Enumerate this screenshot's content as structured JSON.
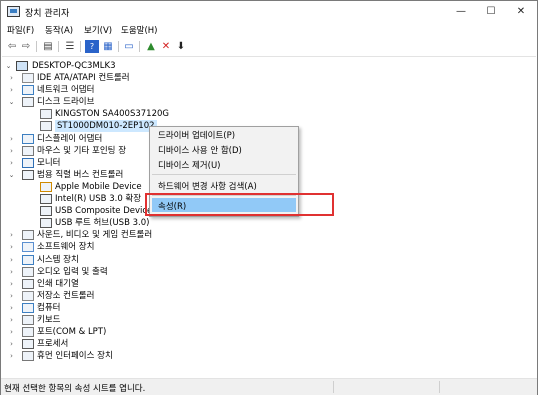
{
  "window": {
    "title": "장치 관리자",
    "buttons": {
      "minimize": "—",
      "maximize": "☐",
      "close": "✕"
    }
  },
  "menu": [
    "파일(F)",
    "동작(A)",
    "보기(V)",
    "도움말(H)"
  ],
  "toolbar_icons": [
    "back-arrow-icon",
    "forward-arrow-icon",
    "properties-icon",
    "list-icon",
    "help-icon",
    "device-view-icon",
    "monitor-icon",
    "add-driver-icon",
    "uninstall-icon",
    "disable-icon"
  ],
  "tree": {
    "root": "DESKTOP-QC3MLK3",
    "items": [
      {
        "label": "IDE ATA/ATAPI 컨트롤러",
        "expander": "›",
        "icon": "ide-controller-icon"
      },
      {
        "label": "네트워크 어댑터",
        "expander": "›",
        "icon": "network-adapter-icon"
      },
      {
        "label": "디스크 드라이브",
        "expander": "⌄",
        "icon": "disk-drive-icon"
      },
      {
        "label": "KINGSTON SA400S37120G",
        "expander": "",
        "icon": "disk-icon"
      },
      {
        "label": "ST1000DM010-2EP102",
        "expander": "",
        "icon": "disk-icon"
      },
      {
        "label": "디스플레이 어댑터",
        "expander": "›",
        "icon": "display-adapter-icon"
      },
      {
        "label": "마우스 및 기타 포인팅 장",
        "expander": "›",
        "icon": "mouse-icon"
      },
      {
        "label": "모니터",
        "expander": "›",
        "icon": "monitor-icon"
      },
      {
        "label": "범용 직렬 버스 컨트롤러",
        "expander": "⌄",
        "icon": "usb-controller-icon"
      },
      {
        "label": "Apple Mobile Device",
        "expander": "",
        "icon": "warning-device-icon"
      },
      {
        "label": "Intel(R) USB 3.0 확장",
        "expander": "",
        "icon": "usb-icon"
      },
      {
        "label": "USB Composite Device",
        "expander": "",
        "icon": "usb-icon"
      },
      {
        "label": "USB 루트 허브(USB 3.0)",
        "expander": "",
        "icon": "usb-icon"
      },
      {
        "label": "사운드, 비디오 및 게임 컨트롤러",
        "expander": "›",
        "icon": "sound-icon"
      },
      {
        "label": "소프트웨어 장치",
        "expander": "›",
        "icon": "software-device-icon"
      },
      {
        "label": "시스템 장치",
        "expander": "›",
        "icon": "system-device-icon"
      },
      {
        "label": "오디오 입력 및 출력",
        "expander": "›",
        "icon": "audio-icon"
      },
      {
        "label": "인쇄 대기열",
        "expander": "›",
        "icon": "printer-icon"
      },
      {
        "label": "저장소 컨트롤러",
        "expander": "›",
        "icon": "storage-controller-icon"
      },
      {
        "label": "컴퓨터",
        "expander": "›",
        "icon": "computer-icon"
      },
      {
        "label": "키보드",
        "expander": "›",
        "icon": "keyboard-icon"
      },
      {
        "label": "포트(COM & LPT)",
        "expander": "›",
        "icon": "port-icon"
      },
      {
        "label": "프로세서",
        "expander": "›",
        "icon": "processor-icon"
      },
      {
        "label": "휴먼 인터페이스 장치",
        "expander": "›",
        "icon": "hid-icon"
      }
    ]
  },
  "context_menu": {
    "items": [
      "드라이버 업데이트(P)",
      "디바이스 사용 안 함(D)",
      "디바이스 제거(U)",
      "하드웨어 변경 사항 검색(A)",
      "속성(R)"
    ],
    "highlighted": "속성(R)"
  },
  "status_bar": {
    "text": "현재 선택한 항목의 속성 시트를 엽니다."
  },
  "colors": {
    "highlight": "#91c9f7",
    "selection": "#cde8ff",
    "annotation": "#e03131"
  }
}
